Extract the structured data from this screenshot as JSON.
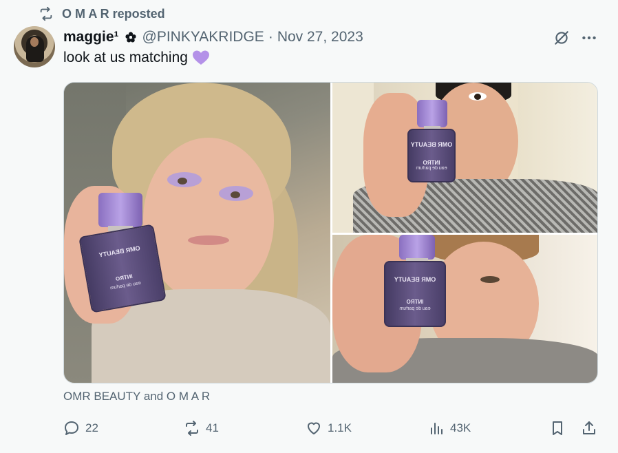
{
  "repost_banner": {
    "text": "O M A R reposted"
  },
  "author": {
    "display_name": "maggie¹",
    "handle": "@PINKYAKRIDGE",
    "separator": "·",
    "date": "Nov 27, 2023"
  },
  "tweet": {
    "text": "look at us matching",
    "emoji": "purple-heart"
  },
  "media": {
    "count": 3,
    "bottle_label": "OMR BEAUTY",
    "bottle_name": "INTRO",
    "bottle_sub": "eau de parfum"
  },
  "caption": "OMR BEAUTY and O M A R",
  "actions": {
    "replies": "22",
    "reposts": "41",
    "likes": "1.1K",
    "views": "43K"
  },
  "colors": {
    "background": "#f7f9f9",
    "primary_text": "#0f1419",
    "secondary_text": "#536471",
    "heart_emoji": "#b491e8"
  },
  "icons": [
    "repost-icon",
    "flower-badge-icon",
    "grok-icon",
    "more-icon",
    "reply-icon",
    "retweet-icon",
    "like-icon",
    "views-icon",
    "bookmark-icon",
    "share-icon"
  ]
}
